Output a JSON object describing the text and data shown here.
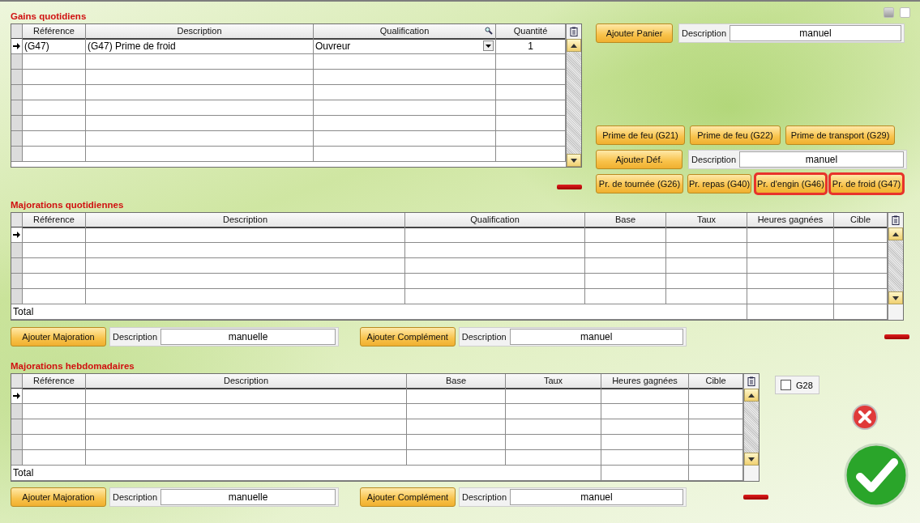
{
  "gains": {
    "title": "Gains quotidiens",
    "columns": [
      "Référence",
      "Description",
      "Qualification",
      "Quantité"
    ],
    "rows": [
      {
        "current": true,
        "cells": [
          "(G47)",
          "(G47) Prime de froid",
          "Ouvreur",
          "1"
        ]
      },
      {
        "current": false
      },
      {
        "current": false
      },
      {
        "current": false
      },
      {
        "current": false
      },
      {
        "current": false
      },
      {
        "current": false
      },
      {
        "current": false
      }
    ]
  },
  "right_panel": {
    "panier": {
      "button": "Ajouter Panier",
      "label": "Description",
      "value": "manuel"
    },
    "primes_row": [
      {
        "label": "Prime de feu (G21)",
        "highlighted": false
      },
      {
        "label": "Prime de feu (G22)",
        "highlighted": false
      },
      {
        "label": "Prime de transport (G29)",
        "highlighted": false
      }
    ],
    "defaut": {
      "button": "Ajouter Déf.",
      "label": "Description",
      "value": "manuel"
    },
    "primes_row_2": [
      {
        "label": "Pr. de tournée (G26)",
        "highlighted": false
      },
      {
        "label": "Pr. repas (G40)",
        "highlighted": false
      },
      {
        "label": "Pr. d'engin (G46)",
        "highlighted": true
      },
      {
        "label": "Pr. de froid (G47)",
        "highlighted": true
      }
    ]
  },
  "majorations_quotidiennes": {
    "title": "Majorations quotidiennes",
    "columns": [
      "Référence",
      "Description",
      "Qualification",
      "Base",
      "Taux",
      "Heures gagnées",
      "Cible"
    ],
    "rows": [
      {
        "current": true
      },
      {
        "current": false
      },
      {
        "current": false
      },
      {
        "current": false
      },
      {
        "current": false
      }
    ],
    "total": "Total",
    "actions": [
      {
        "button": "Ajouter Majoration",
        "label": "Description",
        "value": "manuelle"
      },
      {
        "button": "Ajouter Complément",
        "label": "Description",
        "value": "manuel"
      }
    ]
  },
  "majorations_hebdomadaires": {
    "title": "Majorations hebdomadaires",
    "columns": [
      "Référence",
      "Description",
      "Base",
      "Taux",
      "Heures gagnées",
      "Cible"
    ],
    "rows": [
      {
        "current": true
      },
      {
        "current": false
      },
      {
        "current": false
      },
      {
        "current": false
      },
      {
        "current": false
      }
    ],
    "total": "Total",
    "actions": [
      {
        "button": "Ajouter Majoration",
        "label": "Description",
        "value": "manuelle"
      },
      {
        "button": "Ajouter Complément",
        "label": "Description",
        "value": "manuel"
      }
    ]
  },
  "g28": {
    "label": "G28",
    "checked": false
  }
}
